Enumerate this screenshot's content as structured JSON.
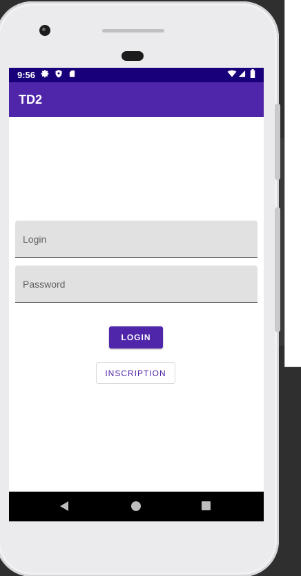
{
  "status_bar": {
    "time": "9:56",
    "left_icons": [
      "gear-icon",
      "shield-icon",
      "sd-card-icon"
    ],
    "right_icons": [
      "wifi-icon",
      "signal-icon",
      "battery-icon"
    ]
  },
  "app_bar": {
    "title": "TD2"
  },
  "form": {
    "login_placeholder": "Login",
    "password_placeholder": "Password",
    "login_button": "LOGIN",
    "inscription_button": "INSCRIPTION"
  },
  "nav_bar": {
    "icons": [
      "back-icon",
      "home-icon",
      "recents-icon"
    ]
  },
  "colors": {
    "status_bar": "#18007a",
    "primary": "#4f26aa",
    "field_bg": "#e1e1e1"
  }
}
